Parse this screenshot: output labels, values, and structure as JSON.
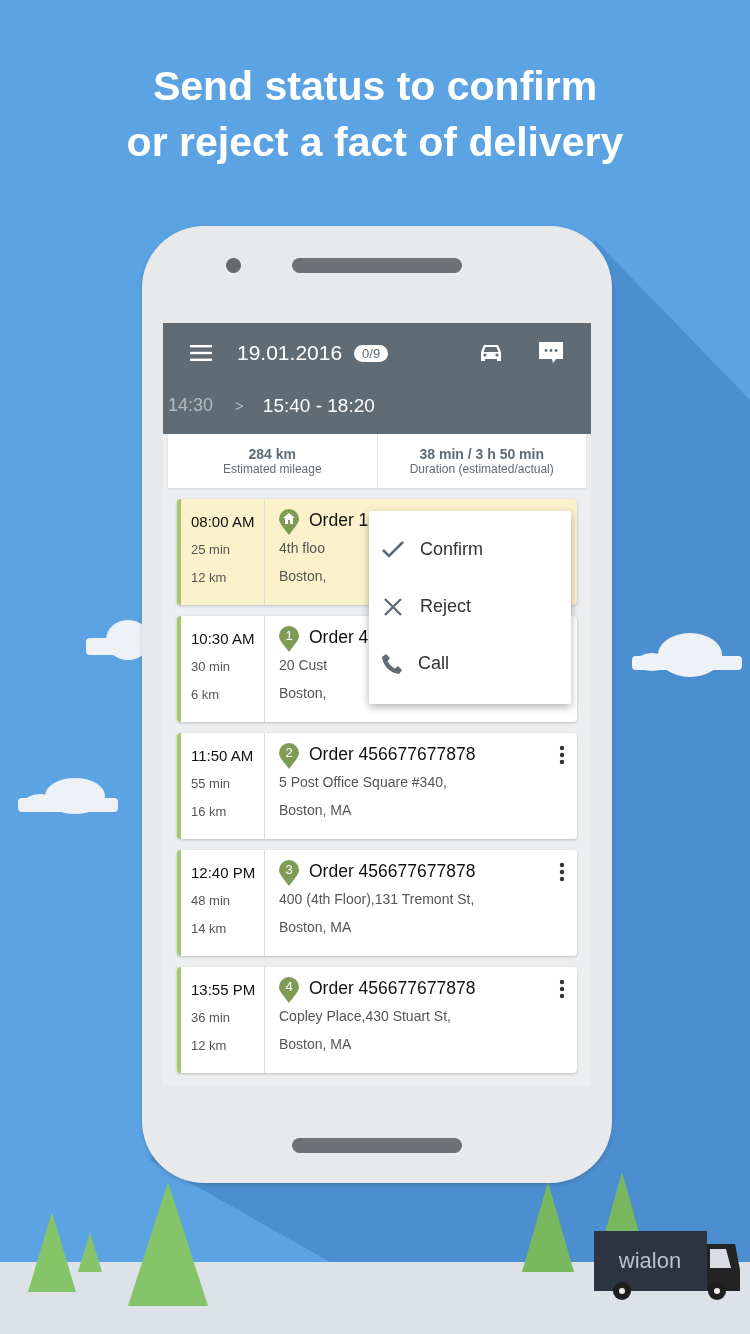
{
  "headline": [
    "Send status to confirm",
    "or reject a fact of delivery"
  ],
  "app_bar": {
    "date": "19.01.2016",
    "badge": "0/9",
    "previous_slot": "14:30",
    "chevron": ">",
    "time_slot": "15:40 - 18:20"
  },
  "summary": [
    {
      "value": "284 km",
      "label": "Estimated mileage"
    },
    {
      "value": "38 min / 3 h 50 min",
      "label": "Duration (estimated/actual)"
    }
  ],
  "orders": [
    {
      "time": "08:00 AM",
      "duration": "25 min",
      "distance": "12 km",
      "kind": "home",
      "title": "Order 1",
      "address": [
        "4th floo",
        "Boston,"
      ],
      "selected": true,
      "more_button": false
    },
    {
      "time": "10:30 AM",
      "duration": "30 min",
      "distance": "6 km",
      "kind": "numbered",
      "marker": "1",
      "title": "Order 4",
      "address": [
        "20 Cust",
        "Boston,"
      ],
      "selected": false,
      "more_button": false
    },
    {
      "time": "11:50 AM",
      "duration": "55 min",
      "distance": "16 km",
      "kind": "numbered",
      "marker": "2",
      "title": "Order 456677677878",
      "address": [
        "5 Post Office Square #340,",
        "Boston, MA"
      ],
      "selected": false,
      "more_button": true
    },
    {
      "time": "12:40 PM",
      "duration": "48 min",
      "distance": "14 km",
      "kind": "numbered",
      "marker": "3",
      "title": "Order 456677677878",
      "address": [
        "400 (4th Floor),131 Tremont St,",
        "Boston, MA"
      ],
      "selected": false,
      "more_button": true
    },
    {
      "time": "13:55 PM",
      "duration": "36 min",
      "distance": "12 km",
      "kind": "numbered",
      "marker": "4",
      "title": "Order 456677677878",
      "address": [
        "Copley Place,430 Stuart St,",
        "Boston, MA"
      ],
      "selected": false,
      "more_button": true
    }
  ],
  "context_menu": [
    {
      "kind": "confirm",
      "label": "Confirm"
    },
    {
      "kind": "reject",
      "label": "Reject"
    },
    {
      "kind": "call",
      "label": "Call"
    }
  ],
  "truck_logo": "wialon"
}
